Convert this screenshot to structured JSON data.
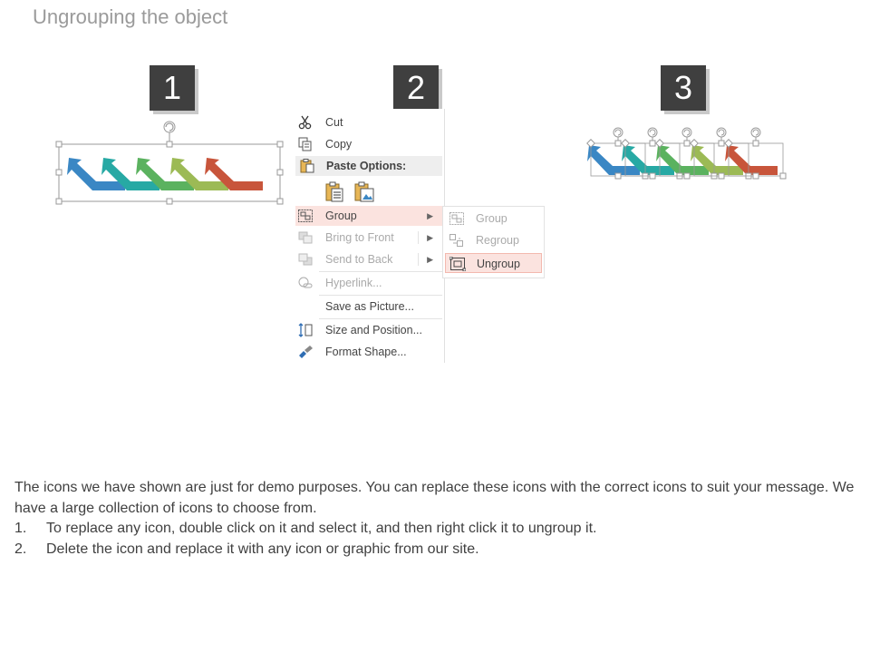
{
  "slide": {
    "title": "Ungrouping the object"
  },
  "steps": [
    {
      "number": "1"
    },
    {
      "number": "2"
    },
    {
      "number": "3"
    }
  ],
  "arrow_colors": [
    "#3a87c4",
    "#27a9a4",
    "#5bb25f",
    "#9cba55",
    "#c8553b"
  ],
  "context_menu": {
    "items": [
      {
        "label": "Cut",
        "icon": "scissors-icon",
        "enabled": true
      },
      {
        "label": "Copy",
        "icon": "copy-icon",
        "enabled": true
      },
      {
        "label": "Paste Options:",
        "icon": "paste-icon",
        "enabled": true
      },
      {
        "label": "Group",
        "icon": "group-icon",
        "enabled": true
      },
      {
        "label": "Bring to Front",
        "icon": "bring-to-front-icon",
        "enabled": false
      },
      {
        "label": "Send to Back",
        "icon": "send-to-back-icon",
        "enabled": false
      },
      {
        "label": "Hyperlink...",
        "icon": "hyperlink-icon",
        "enabled": false
      },
      {
        "label": "Save as Picture...",
        "icon": "",
        "enabled": true
      },
      {
        "label": "Size and Position...",
        "icon": "size-position-icon",
        "enabled": true
      },
      {
        "label": "Format Shape...",
        "icon": "format-shape-icon",
        "enabled": true
      }
    ],
    "paste_option_icons": [
      "paste-keep-formatting-icon",
      "paste-picture-icon"
    ],
    "highlighted": "Group"
  },
  "group_submenu": {
    "items": [
      {
        "label": "Group",
        "icon": "group-icon",
        "enabled": false
      },
      {
        "label": "Regroup",
        "icon": "regroup-icon",
        "enabled": false
      },
      {
        "label": "Ungroup",
        "icon": "ungroup-icon",
        "enabled": true
      }
    ],
    "highlighted": "Ungroup"
  },
  "description": {
    "intro": "The icons we have shown are just for demo purposes. You can replace these icons with the correct icons to suit your message. We have a large collection of icons to choose from.",
    "steps": [
      {
        "number": "1.",
        "text": "To replace any icon, double click on it and select it, and then right click it to ungroup it."
      },
      {
        "number": "2.",
        "text": "Delete the icon and replace it with any icon or graphic from our site."
      }
    ]
  }
}
